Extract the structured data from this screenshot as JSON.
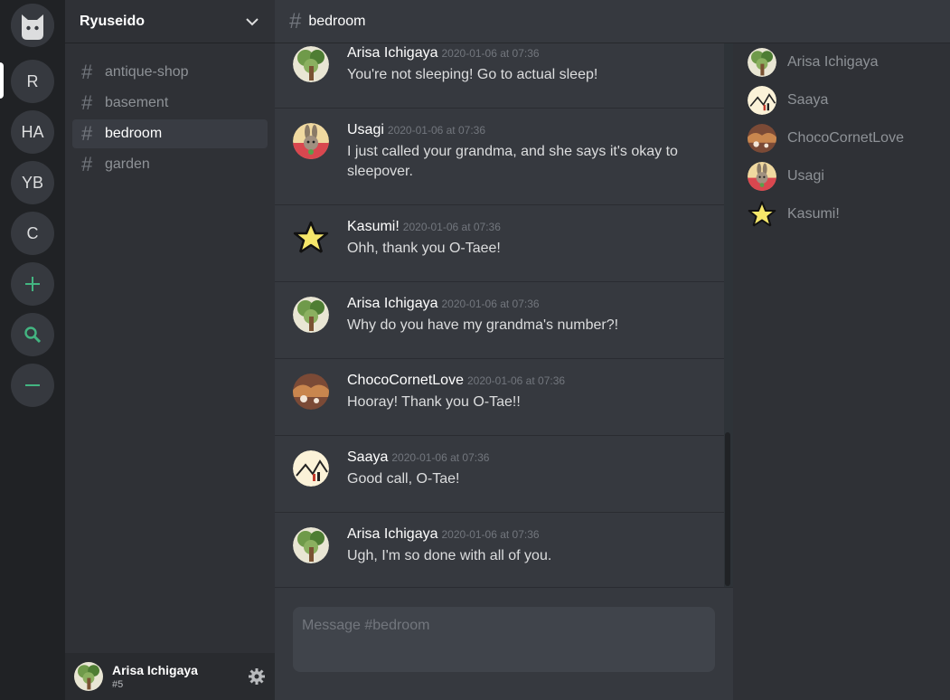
{
  "servers": {
    "home_icon": "cat-icon",
    "items": [
      {
        "label": "R"
      },
      {
        "label": "HA"
      },
      {
        "label": "YB"
      },
      {
        "label": "C"
      }
    ],
    "actions": [
      {
        "label": "+",
        "icon": "plus-icon"
      },
      {
        "icon": "search-icon"
      },
      {
        "label": "−",
        "icon": "minus-icon"
      }
    ],
    "accent": "#43b581"
  },
  "guild": {
    "name": "Ryuseido",
    "channels": [
      {
        "name": "antique-shop",
        "active": false
      },
      {
        "name": "basement",
        "active": false
      },
      {
        "name": "bedroom",
        "active": true
      },
      {
        "name": "garden",
        "active": false
      }
    ]
  },
  "user_panel": {
    "name": "Arisa Ichigaya",
    "discriminator": "#5"
  },
  "chat": {
    "channel": "bedroom",
    "placeholder": "Message #bedroom",
    "messages": [
      {
        "author": "Arisa Ichigaya",
        "timestamp": "2020-01-06 at 07:36",
        "text": "You're not sleeping! Go to actual sleep!"
      },
      {
        "author": "Usagi",
        "timestamp": "2020-01-06 at 07:36",
        "text": "I just called your grandma, and she says it's okay to sleepover."
      },
      {
        "author": "Kasumi!",
        "timestamp": "2020-01-06 at 07:36",
        "text": "Ohh, thank you O-Taee!"
      },
      {
        "author": "Arisa Ichigaya",
        "timestamp": "2020-01-06 at 07:36",
        "text": "Why do you have my grandma's number?!"
      },
      {
        "author": "ChocoCornetLove",
        "timestamp": "2020-01-06 at 07:36",
        "text": "Hooray! Thank you O-Tae!!"
      },
      {
        "author": "Saaya",
        "timestamp": "2020-01-06 at 07:36",
        "text": "Good call, O-Tae!"
      },
      {
        "author": "Arisa Ichigaya",
        "timestamp": "2020-01-06 at 07:36",
        "text": "Ugh, I'm so done with all of you."
      }
    ]
  },
  "members": [
    {
      "name": "Arisa Ichigaya"
    },
    {
      "name": "Saaya"
    },
    {
      "name": "ChocoCornetLove"
    },
    {
      "name": "Usagi"
    },
    {
      "name": "Kasumi!"
    }
  ]
}
